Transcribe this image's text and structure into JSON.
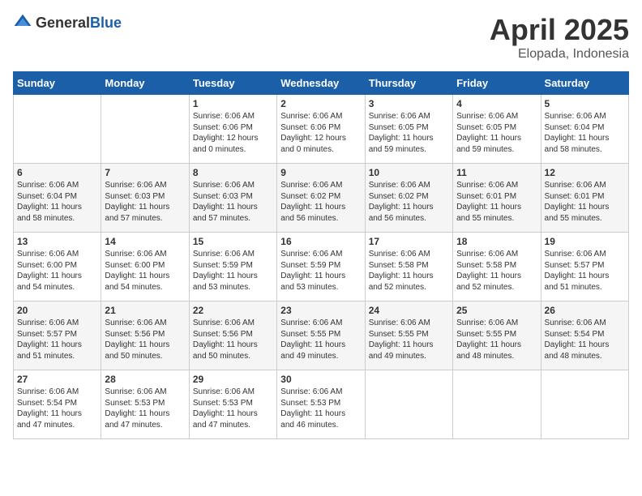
{
  "logo": {
    "general": "General",
    "blue": "Blue"
  },
  "header": {
    "month": "April 2025",
    "location": "Elopada, Indonesia"
  },
  "weekdays": [
    "Sunday",
    "Monday",
    "Tuesday",
    "Wednesday",
    "Thursday",
    "Friday",
    "Saturday"
  ],
  "weeks": [
    [
      {
        "day": "",
        "content": ""
      },
      {
        "day": "",
        "content": ""
      },
      {
        "day": "1",
        "content": "Sunrise: 6:06 AM\nSunset: 6:06 PM\nDaylight: 12 hours\nand 0 minutes."
      },
      {
        "day": "2",
        "content": "Sunrise: 6:06 AM\nSunset: 6:06 PM\nDaylight: 12 hours\nand 0 minutes."
      },
      {
        "day": "3",
        "content": "Sunrise: 6:06 AM\nSunset: 6:05 PM\nDaylight: 11 hours\nand 59 minutes."
      },
      {
        "day": "4",
        "content": "Sunrise: 6:06 AM\nSunset: 6:05 PM\nDaylight: 11 hours\nand 59 minutes."
      },
      {
        "day": "5",
        "content": "Sunrise: 6:06 AM\nSunset: 6:04 PM\nDaylight: 11 hours\nand 58 minutes."
      }
    ],
    [
      {
        "day": "6",
        "content": "Sunrise: 6:06 AM\nSunset: 6:04 PM\nDaylight: 11 hours\nand 58 minutes."
      },
      {
        "day": "7",
        "content": "Sunrise: 6:06 AM\nSunset: 6:03 PM\nDaylight: 11 hours\nand 57 minutes."
      },
      {
        "day": "8",
        "content": "Sunrise: 6:06 AM\nSunset: 6:03 PM\nDaylight: 11 hours\nand 57 minutes."
      },
      {
        "day": "9",
        "content": "Sunrise: 6:06 AM\nSunset: 6:02 PM\nDaylight: 11 hours\nand 56 minutes."
      },
      {
        "day": "10",
        "content": "Sunrise: 6:06 AM\nSunset: 6:02 PM\nDaylight: 11 hours\nand 56 minutes."
      },
      {
        "day": "11",
        "content": "Sunrise: 6:06 AM\nSunset: 6:01 PM\nDaylight: 11 hours\nand 55 minutes."
      },
      {
        "day": "12",
        "content": "Sunrise: 6:06 AM\nSunset: 6:01 PM\nDaylight: 11 hours\nand 55 minutes."
      }
    ],
    [
      {
        "day": "13",
        "content": "Sunrise: 6:06 AM\nSunset: 6:00 PM\nDaylight: 11 hours\nand 54 minutes."
      },
      {
        "day": "14",
        "content": "Sunrise: 6:06 AM\nSunset: 6:00 PM\nDaylight: 11 hours\nand 54 minutes."
      },
      {
        "day": "15",
        "content": "Sunrise: 6:06 AM\nSunset: 5:59 PM\nDaylight: 11 hours\nand 53 minutes."
      },
      {
        "day": "16",
        "content": "Sunrise: 6:06 AM\nSunset: 5:59 PM\nDaylight: 11 hours\nand 53 minutes."
      },
      {
        "day": "17",
        "content": "Sunrise: 6:06 AM\nSunset: 5:58 PM\nDaylight: 11 hours\nand 52 minutes."
      },
      {
        "day": "18",
        "content": "Sunrise: 6:06 AM\nSunset: 5:58 PM\nDaylight: 11 hours\nand 52 minutes."
      },
      {
        "day": "19",
        "content": "Sunrise: 6:06 AM\nSunset: 5:57 PM\nDaylight: 11 hours\nand 51 minutes."
      }
    ],
    [
      {
        "day": "20",
        "content": "Sunrise: 6:06 AM\nSunset: 5:57 PM\nDaylight: 11 hours\nand 51 minutes."
      },
      {
        "day": "21",
        "content": "Sunrise: 6:06 AM\nSunset: 5:56 PM\nDaylight: 11 hours\nand 50 minutes."
      },
      {
        "day": "22",
        "content": "Sunrise: 6:06 AM\nSunset: 5:56 PM\nDaylight: 11 hours\nand 50 minutes."
      },
      {
        "day": "23",
        "content": "Sunrise: 6:06 AM\nSunset: 5:55 PM\nDaylight: 11 hours\nand 49 minutes."
      },
      {
        "day": "24",
        "content": "Sunrise: 6:06 AM\nSunset: 5:55 PM\nDaylight: 11 hours\nand 49 minutes."
      },
      {
        "day": "25",
        "content": "Sunrise: 6:06 AM\nSunset: 5:55 PM\nDaylight: 11 hours\nand 48 minutes."
      },
      {
        "day": "26",
        "content": "Sunrise: 6:06 AM\nSunset: 5:54 PM\nDaylight: 11 hours\nand 48 minutes."
      }
    ],
    [
      {
        "day": "27",
        "content": "Sunrise: 6:06 AM\nSunset: 5:54 PM\nDaylight: 11 hours\nand 47 minutes."
      },
      {
        "day": "28",
        "content": "Sunrise: 6:06 AM\nSunset: 5:53 PM\nDaylight: 11 hours\nand 47 minutes."
      },
      {
        "day": "29",
        "content": "Sunrise: 6:06 AM\nSunset: 5:53 PM\nDaylight: 11 hours\nand 47 minutes."
      },
      {
        "day": "30",
        "content": "Sunrise: 6:06 AM\nSunset: 5:53 PM\nDaylight: 11 hours\nand 46 minutes."
      },
      {
        "day": "",
        "content": ""
      },
      {
        "day": "",
        "content": ""
      },
      {
        "day": "",
        "content": ""
      }
    ]
  ]
}
